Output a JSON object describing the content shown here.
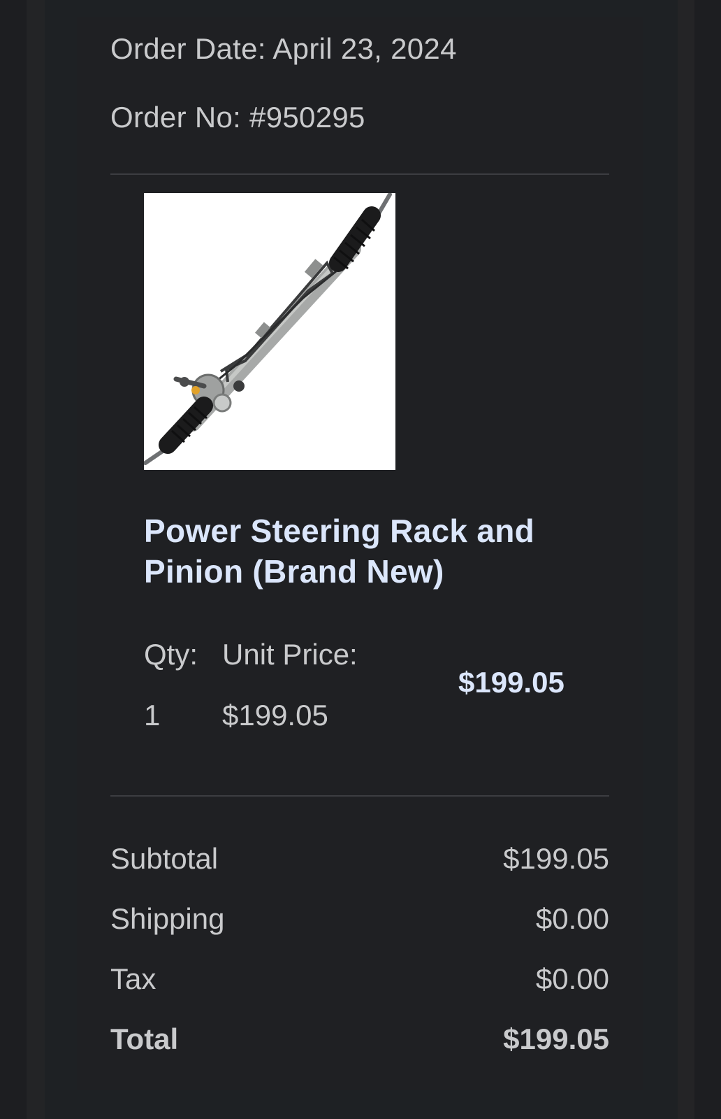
{
  "order": {
    "date_text": "Order Date: April 23, 2024",
    "number_text": "Order No: #950295"
  },
  "item": {
    "image_alt": "Power Steering Rack and Pinion",
    "title": "Power Steering Rack and Pinion (Brand New)",
    "qty_label": "Qty:",
    "unit_price_label": "Unit Price:",
    "qty": "1",
    "unit_price": "$199.05",
    "line_total": "$199.05"
  },
  "summary": {
    "subtotal_label": "Subtotal",
    "subtotal_value": "$199.05",
    "shipping_label": "Shipping",
    "shipping_value": "$0.00",
    "tax_label": "Tax",
    "tax_value": "$0.00",
    "total_label": "Total",
    "total_value": "$199.05"
  },
  "colors": {
    "background": "#1e1f22",
    "card": "#1f2023",
    "text": "#c9cacc",
    "title": "#dbe6fb",
    "divider": "#3c3d41"
  }
}
